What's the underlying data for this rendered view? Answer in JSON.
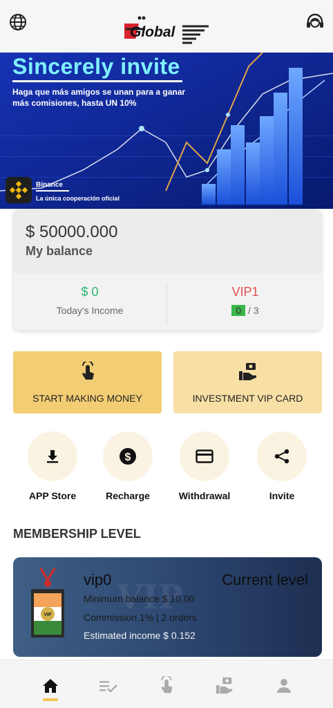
{
  "header": {
    "logo_text": "Global",
    "left_icon": "globe-icon",
    "right_icon": "headset-icon"
  },
  "banner": {
    "title": "Sincerely invite",
    "subtitle": "Haga que más amigos se unan para a ganar más comisiones, hasta UN 10%",
    "brand": "Binance",
    "tagline": "La única cooperación oficial"
  },
  "balance": {
    "amount": "$ 50000.000",
    "label": "My balance",
    "today_income_value": "$ 0",
    "today_income_label": "Today's Income",
    "vip_level": "VIP1",
    "vip_progress_current": "0",
    "vip_progress_total": "/ 3"
  },
  "actions": {
    "start": "START MAKING MONEY",
    "invest": "INVESTMENT VIP CARD"
  },
  "quick": [
    {
      "label": "APP Store",
      "icon": "download-icon"
    },
    {
      "label": "Recharge",
      "icon": "dollar-coin-icon"
    },
    {
      "label": "Withdrawal",
      "icon": "credit-card-icon"
    },
    {
      "label": "Invite",
      "icon": "share-icon"
    }
  ],
  "membership": {
    "title": "MEMBERSHIP LEVEL",
    "level": "vip0",
    "current": "Current level",
    "min_balance": "Minimum balance $ 10.00",
    "commission": "Commission 1% | 2 orders",
    "estimated": "Estimated income $ 0.152",
    "badge_text": "VIP"
  },
  "nav": [
    "home-icon",
    "tasks-icon",
    "tap-icon",
    "invest-icon",
    "user-icon"
  ],
  "colors": {
    "accent": "#f2c24b",
    "income_green": "#2bb673",
    "vip_red": "#e05252",
    "start_bg": "#f2cd73",
    "invest_bg": "#f7dfa6"
  }
}
